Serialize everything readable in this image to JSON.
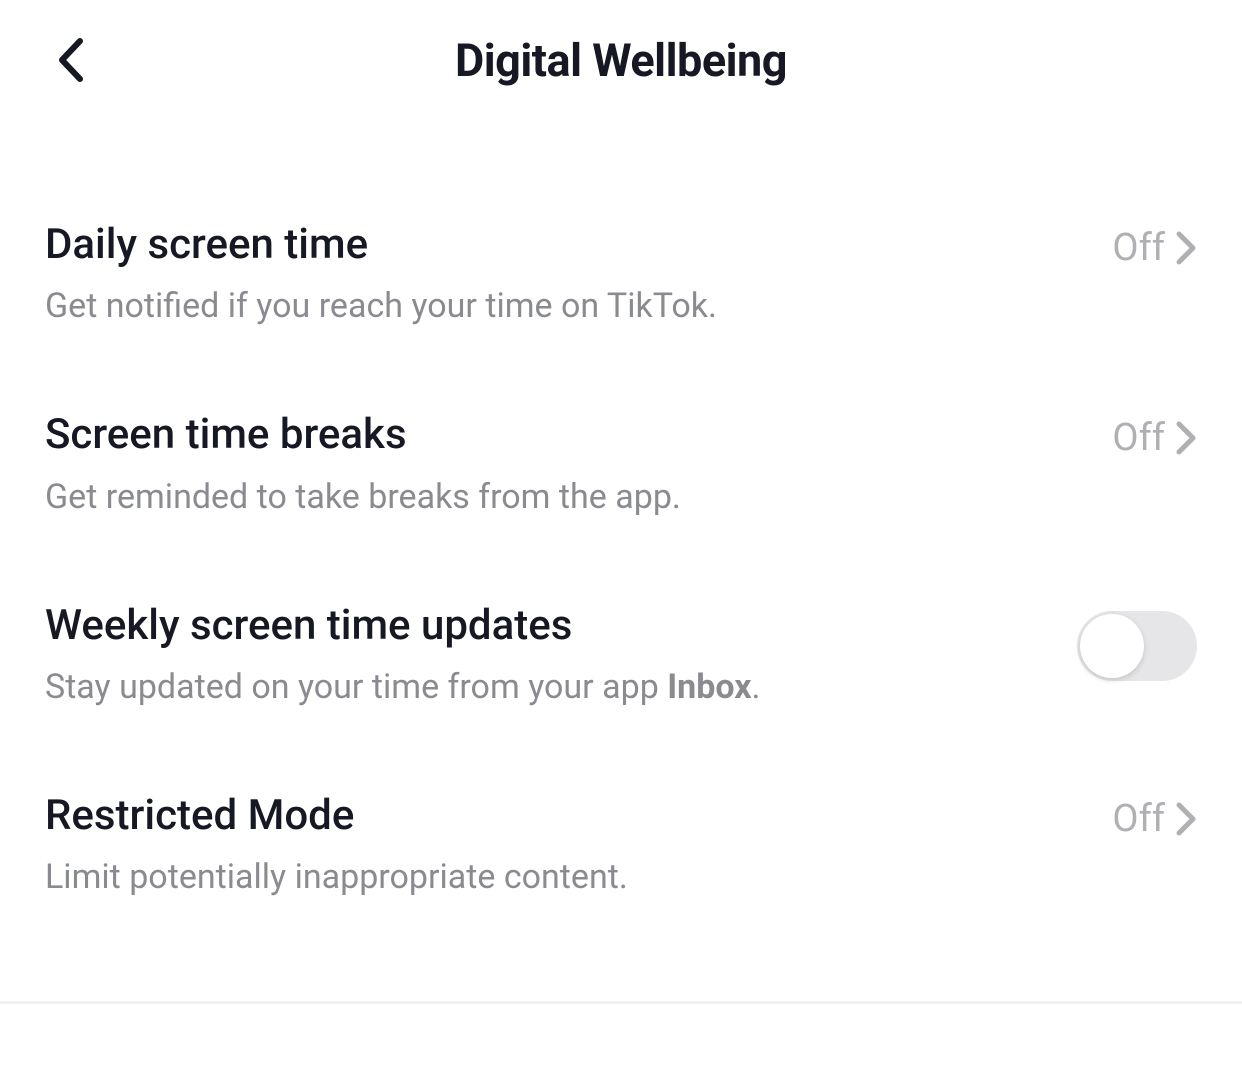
{
  "header": {
    "title": "Digital Wellbeing"
  },
  "settings": {
    "daily_screen_time": {
      "title": "Daily screen time",
      "desc": "Get notified if you reach your time on TikTok.",
      "value": "Off"
    },
    "screen_time_breaks": {
      "title": "Screen time breaks",
      "desc": "Get reminded to take breaks from the app.",
      "value": "Off"
    },
    "weekly_updates": {
      "title": "Weekly screen time updates",
      "desc_pre": "Stay updated on your time from your app ",
      "desc_bold": "Inbox",
      "desc_post": ".",
      "toggle_on": false
    },
    "restricted_mode": {
      "title": "Restricted Mode",
      "desc": "Limit potentially inappropriate content.",
      "value": "Off"
    }
  }
}
